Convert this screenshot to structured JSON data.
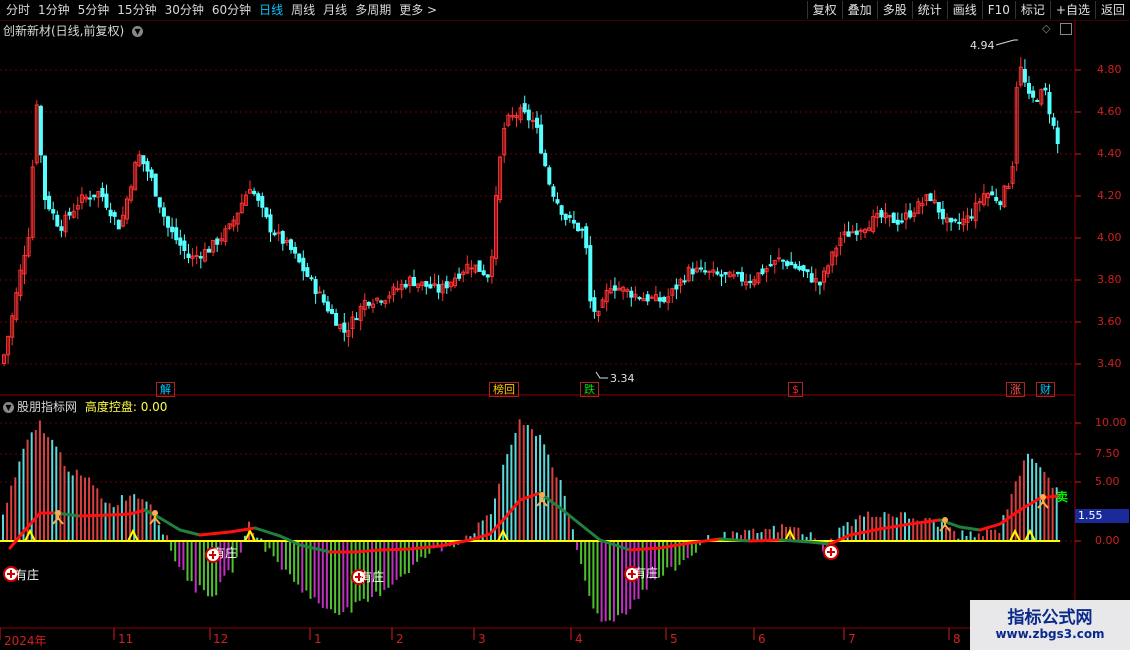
{
  "toolbar": {
    "periods": [
      "分时",
      "1分钟",
      "5分钟",
      "15分钟",
      "30分钟",
      "60分钟",
      "日线",
      "周线",
      "月线",
      "多周期",
      "更多 >"
    ],
    "active_period": "日线",
    "buttons": [
      "复权",
      "叠加",
      "多股",
      "统计",
      "画线",
      "F10",
      "标记",
      "+自选",
      "返回"
    ]
  },
  "main_chart": {
    "title": "创新新材(日线,前复权)",
    "price_axis": [
      "4.80",
      "4.60",
      "4.40",
      "4.20",
      "4.00",
      "3.80",
      "3.60",
      "3.40"
    ],
    "high_marker": "4.94",
    "low_marker": "3.34",
    "event_badges": [
      {
        "text": "解",
        "color": "#00c8ff"
      },
      {
        "text": "榜回",
        "color": "#ffcc00"
      },
      {
        "text": "跌",
        "color": "#00dd00"
      },
      {
        "text": "$",
        "color": "#ff2222"
      },
      {
        "text": "涨",
        "color": "#ff5555"
      },
      {
        "text": "财",
        "color": "#00c8ff"
      }
    ]
  },
  "indicator": {
    "name": "股朋指标网",
    "param_label": "高度控盘:",
    "param_value": "0.00",
    "axis": [
      "10.00",
      "7.50",
      "5.00",
      "0.00"
    ],
    "current_value": "1.55",
    "signal_labels": [
      "有庄",
      "有庄",
      "有庄",
      "有庄"
    ],
    "sell_label": "卖"
  },
  "date_axis": [
    "2024年",
    "11",
    "12",
    "1",
    "2",
    "3",
    "4",
    "5",
    "6",
    "7",
    "8"
  ],
  "watermark": {
    "line1": "指标公式网",
    "line2": "www.zbgs3.com"
  },
  "colors": {
    "up": "#ff3333",
    "down": "#54ffff",
    "grid": "#6a0000",
    "axis_text": "#d02020"
  }
}
